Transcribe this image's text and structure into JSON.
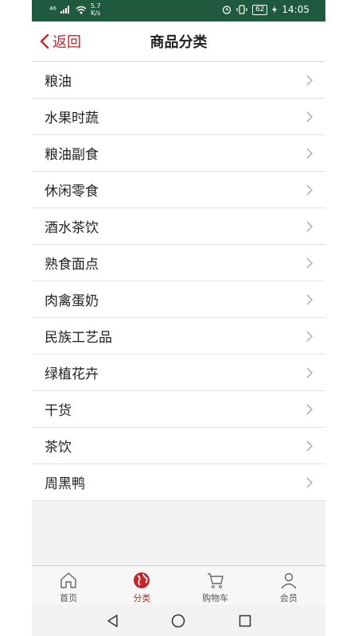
{
  "status_bar": {
    "signal": "⁴⁶",
    "net_speed_value": "5.7",
    "net_speed_unit": "K/s",
    "battery": "62",
    "time": "14:05"
  },
  "header": {
    "back_label": "返回",
    "title": "商品分类"
  },
  "categories": [
    {
      "label": "粮油"
    },
    {
      "label": "水果时蔬"
    },
    {
      "label": "粮油副食"
    },
    {
      "label": "休闲零食"
    },
    {
      "label": "酒水茶饮"
    },
    {
      "label": "熟食面点"
    },
    {
      "label": "肉禽蛋奶"
    },
    {
      "label": "民族工艺品"
    },
    {
      "label": "绿植花卉"
    },
    {
      "label": "干货"
    },
    {
      "label": "茶饮"
    },
    {
      "label": "周黑鸭"
    }
  ],
  "tabbar": {
    "tabs": [
      {
        "label": "首页",
        "icon": "home-icon"
      },
      {
        "label": "分类",
        "icon": "globe-icon",
        "active": true
      },
      {
        "label": "购物车",
        "icon": "cart-icon"
      },
      {
        "label": "会员",
        "icon": "user-icon"
      }
    ]
  },
  "colors": {
    "status_bar": "#1f5a3e",
    "accent": "#c0282d"
  }
}
